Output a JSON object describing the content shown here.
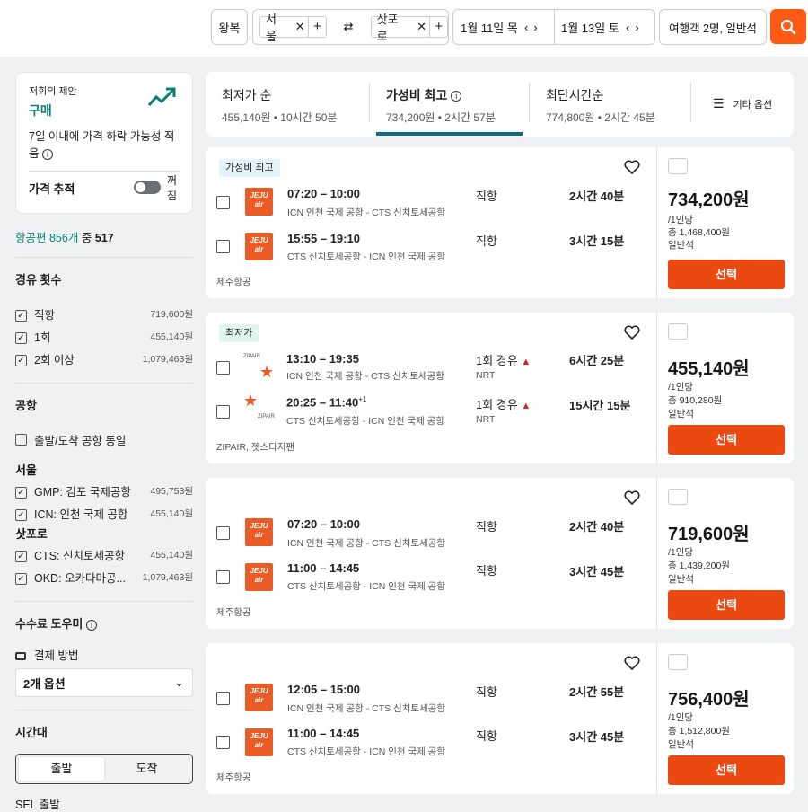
{
  "search": {
    "trip_type": "왕복",
    "origin": "서울",
    "destination": "삿포로",
    "depart_date": "1월 11일 목",
    "return_date": "1월 13일 토",
    "travelers": "여행객 2명, 일반석"
  },
  "advice": {
    "label": "저희의 제안",
    "recommendation": "구매",
    "text": "7일 이내에 가격 하락 가능성 적음",
    "track_label": "가격 추적",
    "toggle_state": "꺼짐"
  },
  "results_count": {
    "prefix": "항공편 856개",
    "middle": "중",
    "count": "517"
  },
  "stops_filter": {
    "title": "경유 횟수",
    "items": [
      {
        "label": "직항",
        "price": "719,600원"
      },
      {
        "label": "1회",
        "price": "455,140원"
      },
      {
        "label": "2회 이상",
        "price": "1,079,463원"
      }
    ]
  },
  "airport_filter": {
    "title": "공항",
    "same_label": "출발/도착 공항 동일",
    "seoul_title": "서울",
    "seoul": [
      {
        "label": "GMP: 김포 국제공항",
        "price": "495,753원"
      },
      {
        "label": "ICN: 인천 국제 공항",
        "price": "455,140원"
      }
    ],
    "sapporo_title": "삿포로",
    "sapporo": [
      {
        "label": "CTS: 신치토세공항",
        "price": "455,140원"
      },
      {
        "label": "OKD: 오카다마공...",
        "price": "1,079,463원"
      }
    ]
  },
  "fee_helper": {
    "title": "수수료 도우미",
    "payment_label": "결제 방법",
    "option": "2개 옵션"
  },
  "time_filter": {
    "title": "시간대",
    "tab_depart": "출발",
    "tab_arrive": "도착",
    "sel_label": "SEL 출발"
  },
  "sort_tabs": [
    {
      "label": "최저가 순",
      "sub": "455,140원 • 10시간 50분"
    },
    {
      "label": "가성비 최고",
      "sub": "734,200원 • 2시간 57분"
    },
    {
      "label": "최단시간순",
      "sub": "774,800원 • 2시간 45분"
    }
  ],
  "more_options": "기타 옵션",
  "results": [
    {
      "badge": "가성비 최고",
      "legs": [
        {
          "time": "07:20 – 10:00",
          "route": "ICN 인천 국제 공항 - CTS 신치토세공항",
          "stops": "직항",
          "stop_code": "",
          "duration": "2시간 40분"
        },
        {
          "time": "15:55 – 19:10",
          "route": "CTS 신치토세공항 - ICN 인천 국제 공항",
          "stops": "직항",
          "stop_code": "",
          "duration": "3시간 15분"
        }
      ],
      "airline": "제주항공",
      "price": "734,200원",
      "per": "/1인당",
      "total": "총 1,468,400원",
      "cabin": "일반석",
      "select": "선택"
    },
    {
      "badge": "최저가",
      "legs": [
        {
          "time": "13:10 – 19:35",
          "route": "ICN 인천 국제 공항 - CTS 신치토세공항",
          "stops": "1회 경유",
          "stop_code": "NRT",
          "duration": "6시간 25분"
        },
        {
          "time": "20:25 – 11:40",
          "sup": "+1",
          "route": "CTS 신치토세공항 - ICN 인천 국제 공항",
          "stops": "1회 경유",
          "stop_code": "NRT",
          "duration": "15시간 15분"
        }
      ],
      "airline": "ZIPAIR, 젯스타저팬",
      "price": "455,140원",
      "per": "/1인당",
      "total": "총 910,280원",
      "cabin": "일반석",
      "select": "선택"
    },
    {
      "badge": "",
      "legs": [
        {
          "time": "07:20 – 10:00",
          "route": "ICN 인천 국제 공항 - CTS 신치토세공항",
          "stops": "직항",
          "stop_code": "",
          "duration": "2시간 40분"
        },
        {
          "time": "11:00 – 14:45",
          "route": "CTS 신치토세공항 - ICN 인천 국제 공항",
          "stops": "직항",
          "stop_code": "",
          "duration": "3시간 45분"
        }
      ],
      "airline": "제주항공",
      "price": "719,600원",
      "per": "/1인당",
      "total": "총 1,439,200원",
      "cabin": "일반석",
      "select": "선택"
    },
    {
      "badge": "",
      "legs": [
        {
          "time": "12:05 – 15:00",
          "route": "ICN 인천 국제 공항 - CTS 신치토세공항",
          "stops": "직항",
          "stop_code": "",
          "duration": "2시간 55분"
        },
        {
          "time": "11:00 – 14:45",
          "route": "CTS 신치토세공항 - ICN 인천 국제 공항",
          "stops": "직항",
          "stop_code": "",
          "duration": "3시간 45분"
        }
      ],
      "airline": "제주항공",
      "price": "756,400원",
      "per": "/1인당",
      "total": "총 1,512,800원",
      "cabin": "일반석",
      "select": "선택"
    }
  ],
  "logos": {
    "jeju_line1": "JEJU",
    "jeju_line2": "air",
    "zipair": "ZIPAIR"
  },
  "colors": {
    "accent": "#ff5b14",
    "select_button": "#ea4a10",
    "teal_text": "#0a7f77",
    "best_badge_bg": "#e2f3fb",
    "cheap_badge_bg": "#dff6ec",
    "warning": "#d1242f"
  }
}
